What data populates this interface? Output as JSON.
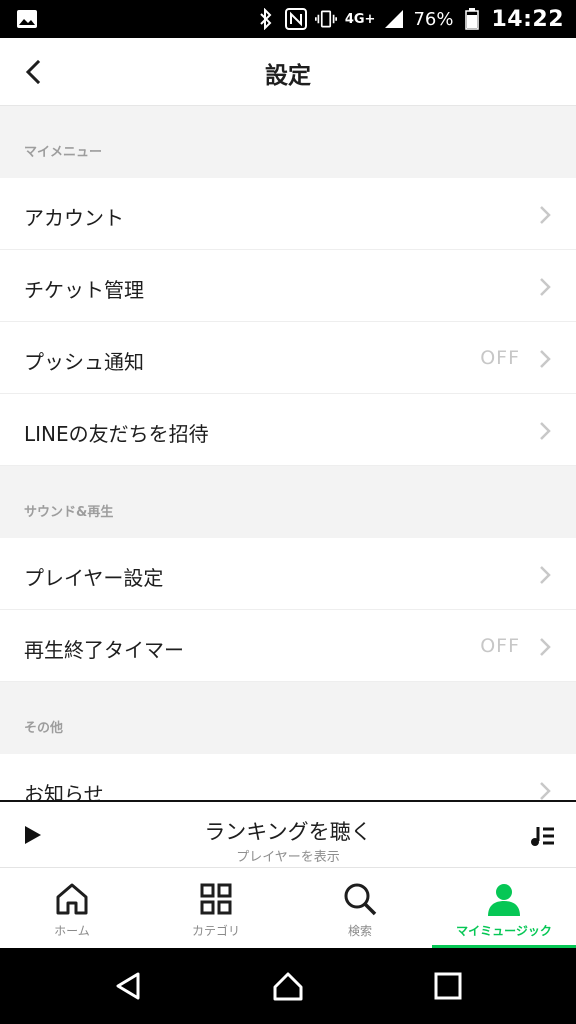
{
  "status_bar": {
    "network": "4G+",
    "battery_percent": "76%",
    "time": "14:22",
    "icons": [
      "image-icon",
      "bluetooth-icon",
      "nfc-icon",
      "vibrate-icon",
      "signal-icon",
      "battery-icon"
    ]
  },
  "header": {
    "title": "設定",
    "back_icon": "chevron-left-icon"
  },
  "sections": [
    {
      "title": "マイメニュー",
      "items": [
        {
          "label": "アカウント",
          "value": ""
        },
        {
          "label": "チケット管理",
          "value": ""
        },
        {
          "label": "プッシュ通知",
          "value": "OFF"
        },
        {
          "label": "LINEの友だちを招待",
          "value": ""
        }
      ]
    },
    {
      "title": "サウンド&再生",
      "items": [
        {
          "label": "プレイヤー設定",
          "value": ""
        },
        {
          "label": "再生終了タイマー",
          "value": "OFF"
        }
      ]
    },
    {
      "title": "その他",
      "items": [
        {
          "label": "お知らせ",
          "value": ""
        }
      ]
    }
  ],
  "mini_player": {
    "title": "ランキングを聴く",
    "subtitle": "プレイヤーを表示"
  },
  "bottom_nav": {
    "items": [
      {
        "label": "ホーム",
        "icon": "home-icon",
        "active": false
      },
      {
        "label": "カテゴリ",
        "icon": "grid-icon",
        "active": false
      },
      {
        "label": "検索",
        "icon": "search-icon",
        "active": false
      },
      {
        "label": "マイミュージック",
        "icon": "person-icon",
        "active": true
      }
    ]
  },
  "colors": {
    "accent": "#06c755",
    "section_bg": "#f3f3f3",
    "value_gray": "#c7c7c7"
  }
}
